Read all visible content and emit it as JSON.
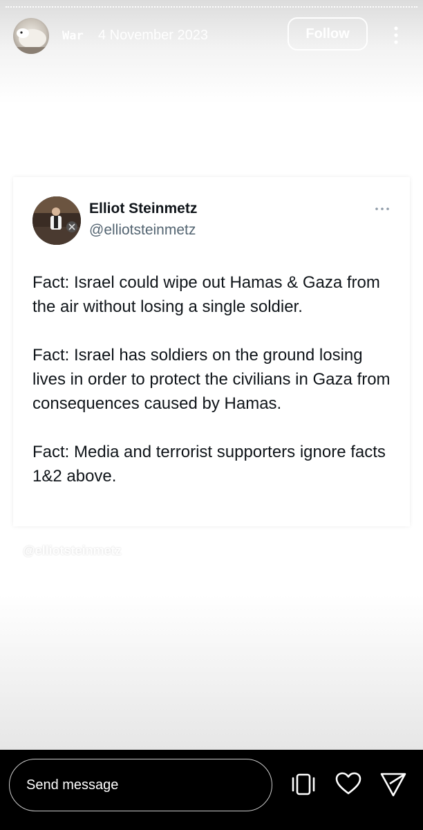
{
  "header": {
    "username": "War",
    "date": "4 November 2023",
    "follow_label": "Follow",
    "icons": {
      "avatar": "account-avatar",
      "more": "more-vertical-icon"
    }
  },
  "tweet": {
    "author_name": "Elliot Steinmetz",
    "author_handle": "@elliotsteinmetz",
    "paragraphs": [
      "Fact: Israel could wipe out Hamas & Gaza from the air without losing a single soldier.",
      "Fact: Israel has soldiers on the ground losing lives in order to protect the civilians in Gaza from consequences caused by Hamas.",
      "Fact: Media and terrorist supporters ignore facts 1&2 above."
    ]
  },
  "watermark": "@elliotsteinmetz",
  "footer": {
    "message_placeholder": "Send message",
    "icons": [
      "repost-icon",
      "heart-icon",
      "send-icon"
    ]
  },
  "colors": {
    "text_primary": "#0f1419",
    "text_secondary": "#536471",
    "bar_background": "#000000"
  }
}
